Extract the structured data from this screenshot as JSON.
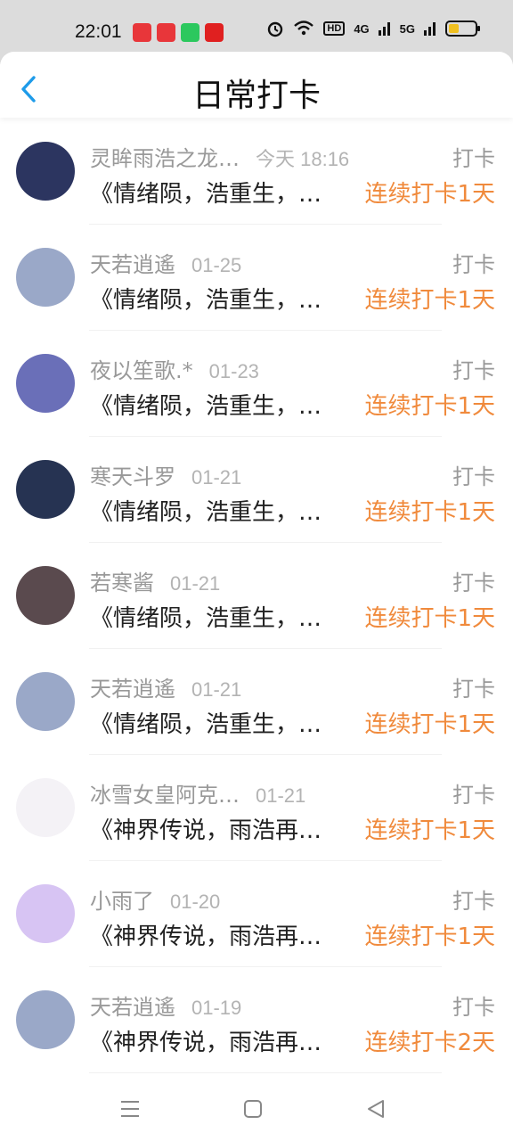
{
  "status_bar": {
    "time": "22:01",
    "hd_label": "HD",
    "net1": "4G",
    "net2": "5G",
    "app_icon_colors": [
      "#e8363a",
      "#e8363a",
      "#2cc85e",
      "#e02020"
    ]
  },
  "header": {
    "title": "日常打卡",
    "accent_color": "#1e9be9"
  },
  "rows": [
    {
      "name": "灵眸雨浩之龙…",
      "date": "今天 18:16",
      "action": "打卡",
      "content": "《情绪陨，浩重生，…",
      "streak": "连续打卡1天",
      "avatar_color": "#2c3560"
    },
    {
      "name": "天若逍遙",
      "date": "01-25",
      "action": "打卡",
      "content": "《情绪陨，浩重生，…",
      "streak": "连续打卡1天",
      "avatar_color": "#9aa8c8"
    },
    {
      "name": "夜以笙歌.*",
      "date": "01-23",
      "action": "打卡",
      "content": "《情绪陨，浩重生，…",
      "streak": "连续打卡1天",
      "avatar_color": "#6a6fb8"
    },
    {
      "name": "寒天斗罗",
      "date": "01-21",
      "action": "打卡",
      "content": "《情绪陨，浩重生，…",
      "streak": "连续打卡1天",
      "avatar_color": "#263352"
    },
    {
      "name": "若寒酱",
      "date": "01-21",
      "action": "打卡",
      "content": "《情绪陨，浩重生，…",
      "streak": "连续打卡1天",
      "avatar_color": "#5a4a4e"
    },
    {
      "name": "天若逍遙",
      "date": "01-21",
      "action": "打卡",
      "content": "《情绪陨，浩重生，…",
      "streak": "连续打卡1天",
      "avatar_color": "#9aa8c8"
    },
    {
      "name": "冰雪女皇阿克…",
      "date": "01-21",
      "action": "打卡",
      "content": "《神界传说，雨浩再…",
      "streak": "连续打卡1天",
      "avatar_color": "#f4f2f6"
    },
    {
      "name": "小雨了",
      "date": "01-20",
      "action": "打卡",
      "content": "《神界传说，雨浩再…",
      "streak": "连续打卡1天",
      "avatar_color": "#d7c4f3"
    },
    {
      "name": "天若逍遙",
      "date": "01-19",
      "action": "打卡",
      "content": "《神界传说，雨浩再…",
      "streak": "连续打卡2天",
      "avatar_color": "#9aa8c8"
    }
  ],
  "nav_bar": {
    "icons": [
      "menu-icon",
      "home-square-icon",
      "back-triangle-icon"
    ]
  }
}
